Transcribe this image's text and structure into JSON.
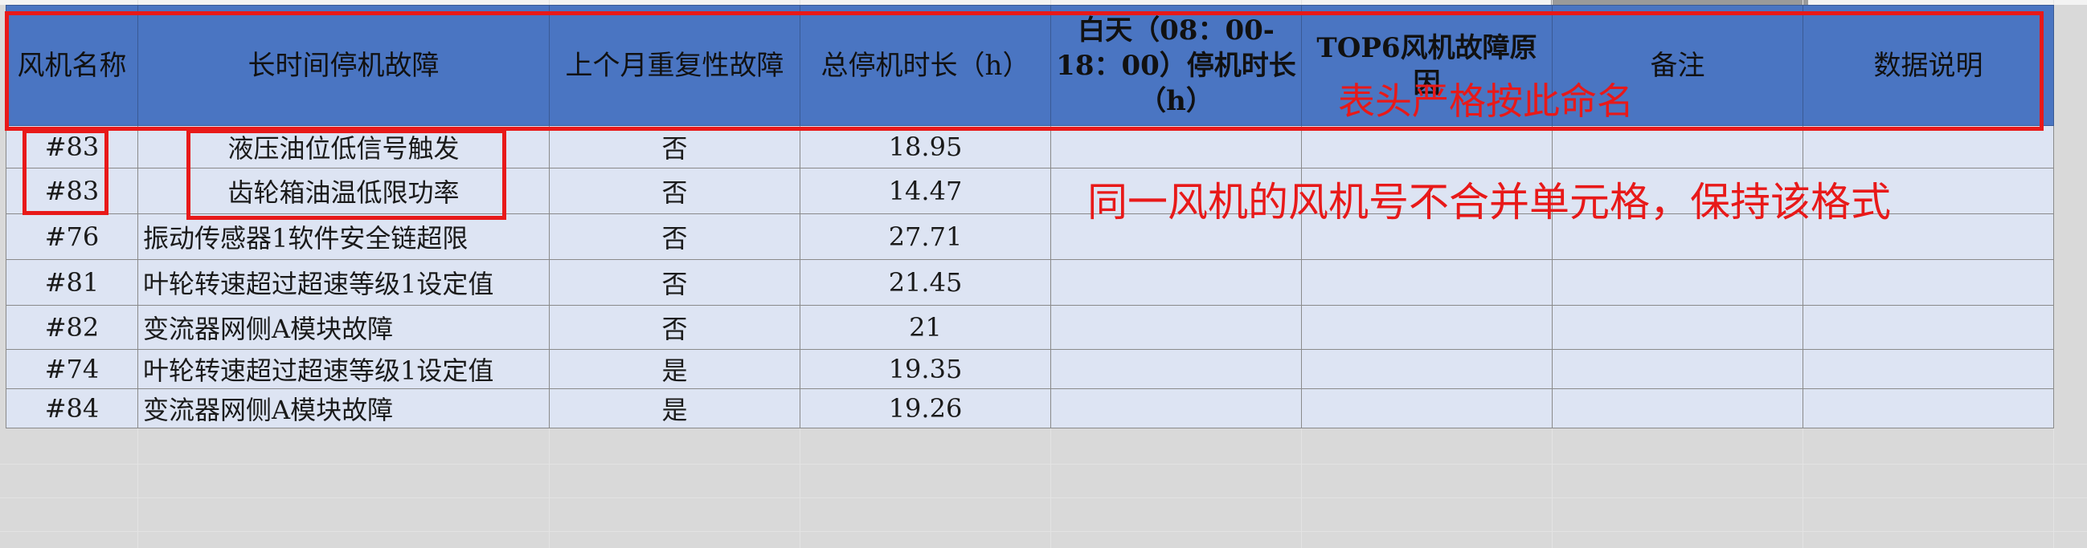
{
  "table": {
    "headers": [
      "风机名称",
      "长时间停机故障",
      "上个月重复性故障",
      "总停机时长（h）",
      "白天（08：00-18：00）停机时长（h）",
      "TOP6风机故障原因",
      "备注",
      "数据说明"
    ],
    "rows": [
      [
        "#83",
        "液压油位低信号触发",
        "否",
        "18.95",
        "",
        "",
        "",
        ""
      ],
      [
        "#83",
        "齿轮箱油温低限功率",
        "否",
        "14.47",
        "",
        "",
        "",
        ""
      ],
      [
        "#76",
        "振动传感器1软件安全链超限",
        "否",
        "27.71",
        "",
        "",
        "",
        ""
      ],
      [
        "#81",
        "叶轮转速超过超速等级1设定值",
        "否",
        "21.45",
        "",
        "",
        "",
        ""
      ],
      [
        "#82",
        "变流器网侧A模块故障",
        "否",
        "21",
        "",
        "",
        "",
        ""
      ],
      [
        "#74",
        "叶轮转速超过超速等级1设定值",
        "是",
        "19.35",
        "",
        "",
        "",
        ""
      ],
      [
        "#84",
        "变流器网侧A模块故障",
        "是",
        "19.26",
        "",
        "",
        "",
        ""
      ]
    ]
  },
  "annotations": {
    "header_note": "表头严格按此命名",
    "merge_note": "同一风机的风机号不合并单元格，保持该格式",
    "color": "#e81919"
  },
  "colors": {
    "header_bg": "#4a75c2",
    "row_bg": "#dde4f3"
  }
}
